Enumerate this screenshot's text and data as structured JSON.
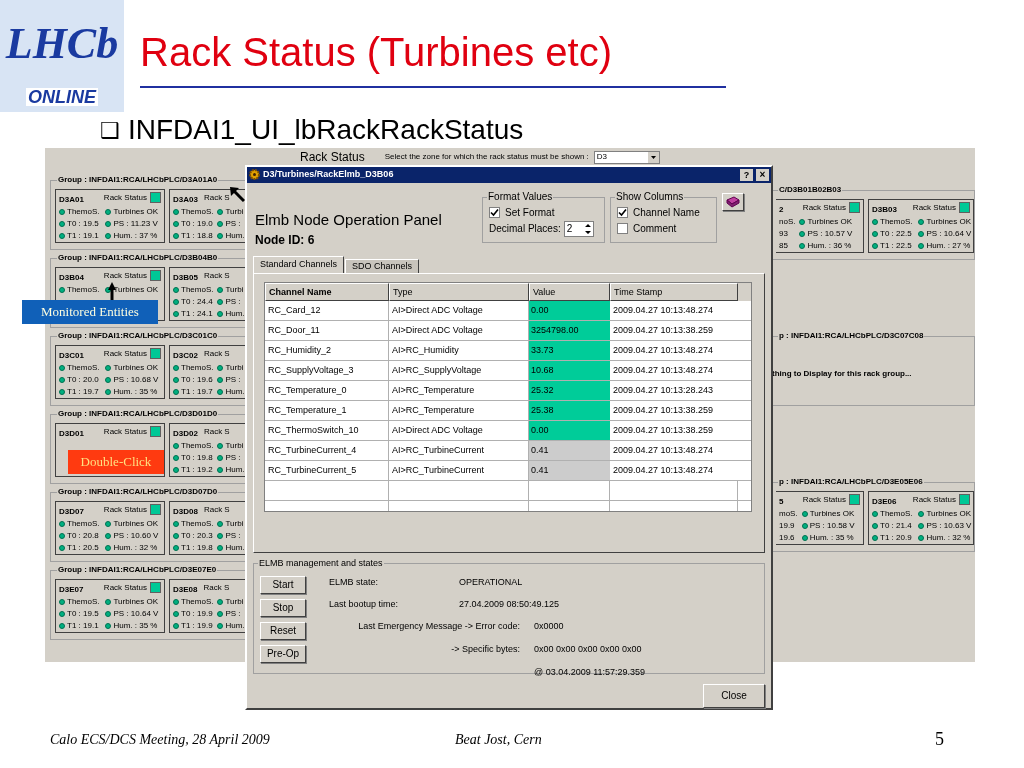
{
  "logo": {
    "text": "LHCb",
    "subtext": "ONLINE"
  },
  "slide_title": "Rack Status (Turbines etc)",
  "subtitle": {
    "bullet": "❑",
    "text": "INFDAI1_UI_lbRackRackStatus"
  },
  "app": {
    "title": "Rack Status",
    "zone_label": "Select the zone for which the rack status must be shown :",
    "zone_value": "D3",
    "left_groups": [
      {
        "title": "Group : INFDAI1:RCA/LHCbPLC/D3A01A0",
        "cards": [
          {
            "name": "D3A01",
            "kind": "full",
            "rack_label": "Rack Status",
            "color": "#00c896",
            "rows": [
              [
                "ThemoS.",
                "Turbines OK"
              ],
              [
                "T0 : 19.5",
                "PS : 11.23 V"
              ],
              [
                "T1 : 19.1",
                "Hum. : 37 %"
              ]
            ]
          },
          {
            "name": "D3A03",
            "kind": "rightcut",
            "rack_label": "Rack S",
            "rows": [
              [
                "ThemoS.",
                "Turbi"
              ],
              [
                "T0 : 19.0",
                "PS :"
              ],
              [
                "T1 : 18.8",
                "Hum."
              ]
            ]
          }
        ]
      },
      {
        "title": "Group : INFDAI1:RCA/LHCbPLC/D3B04B0",
        "cards": [
          {
            "name": "D3B04",
            "kind": "full",
            "rack_label": "Rack Status",
            "color": "#00c896",
            "rows": [
              [
                "ThemoS.",
                "Turbines OK"
              ]
            ]
          },
          {
            "name": "D3B05",
            "kind": "rightcut",
            "rack_label": "Rack S",
            "rows": [
              [
                "ThemoS.",
                "Turbi"
              ],
              [
                "T0 : 24.4",
                "PS :"
              ],
              [
                "T1 : 24.1",
                "Hum."
              ]
            ]
          }
        ]
      },
      {
        "title": "Group : INFDAI1:RCA/LHCbPLC/D3C01C0",
        "cards": [
          {
            "name": "D3C01",
            "kind": "full",
            "rack_label": "Rack Status",
            "color": "#00c896",
            "rows": [
              [
                "ThemoS.",
                "Turbines OK"
              ],
              [
                "T0 : 20.0",
                "PS : 10.68 V"
              ],
              [
                "T1 : 19.7",
                "Hum. : 35 %"
              ]
            ]
          },
          {
            "name": "D3C02",
            "kind": "rightcut",
            "rack_label": "Rack S",
            "rows": [
              [
                "ThemoS.",
                "Turbi"
              ],
              [
                "T0 : 19.6",
                "PS :"
              ],
              [
                "T1 : 19.7",
                "Hum."
              ]
            ]
          }
        ]
      },
      {
        "title": "Group : INFDAI1:RCA/LHCbPLC/D3D01D0",
        "cards": [
          {
            "name": "D3D01",
            "kind": "full",
            "rack_label": "Rack Status",
            "color": "#00c896"
          },
          {
            "name": "D3D02",
            "kind": "rightcut",
            "rack_label": "Rack S",
            "rows": [
              [
                "ThemoS.",
                "Turbi"
              ],
              [
                "T0 : 19.8",
                "PS :"
              ],
              [
                "T1 : 19.2",
                "Hum."
              ]
            ]
          }
        ]
      },
      {
        "title": "Group : INFDAI1:RCA/LHCbPLC/D3D07D0",
        "cards": [
          {
            "name": "D3D07",
            "kind": "full",
            "rack_label": "Rack Status",
            "color": "#00c896",
            "rows": [
              [
                "ThemoS.",
                "Turbines OK"
              ],
              [
                "T0 : 20.8",
                "PS : 10.60 V"
              ],
              [
                "T1 : 20.5",
                "Hum. : 32 %"
              ]
            ]
          },
          {
            "name": "D3D08",
            "kind": "rightcut",
            "rack_label": "Rack S",
            "rows": [
              [
                "ThemoS.",
                "Turbi"
              ],
              [
                "T0 : 20.3",
                "PS :"
              ],
              [
                "T1 : 19.8",
                "Hum."
              ]
            ]
          }
        ]
      },
      {
        "title": "Group : INFDAI1:RCA/LHCbPLC/D3E07E0",
        "cards": [
          {
            "name": "D3E07",
            "kind": "full",
            "rack_label": "Rack Status",
            "color": "#00c896",
            "rows": [
              [
                "ThemoS.",
                "Turbines OK"
              ],
              [
                "T0 : 19.5",
                "PS : 10.64 V"
              ],
              [
                "T1 : 19.1",
                "Hum. : 35 %"
              ]
            ]
          },
          {
            "name": "D3E08",
            "kind": "rightcut",
            "rack_label": "Rack S",
            "rows": [
              [
                "ThemoS.",
                "Turbi"
              ],
              [
                "T0 : 19.9",
                "PS :"
              ],
              [
                "T1 : 19.9",
                "Hum."
              ]
            ]
          }
        ]
      }
    ],
    "right_groups": [
      {
        "title": "C/D3B01B02B03",
        "cards": [
          {
            "name": "2",
            "kind": "leftcut",
            "rack_label": "Rack Status",
            "color": "#00c896",
            "rows": [
              [
                "noS.",
                "Turbines OK"
              ],
              [
                "93",
                "PS : 10.57 V"
              ],
              [
                "85",
                "Hum. : 36 %"
              ]
            ]
          },
          {
            "name": "D3B03",
            "kind": "full",
            "rack_label": "Rack Status",
            "color": "#00c896",
            "rows": [
              [
                "ThemoS.",
                "Turbines OK"
              ],
              [
                "T0 : 22.5",
                "PS : 10.64 V"
              ],
              [
                "T1 : 22.5",
                "Hum. : 27 %"
              ]
            ]
          }
        ]
      },
      {
        "title": "p : INFDAI1:RCA/LHCbPLC/D3C07C08",
        "message": "thing to Display for this rack group..."
      },
      {
        "title": "p : INFDAI1:RCA/LHCbPLC/D3E05E06",
        "cards": [
          {
            "name": "5",
            "kind": "leftcut",
            "rack_label": "Rack Status",
            "color": "#00c896",
            "rows": [
              [
                "moS.",
                "Turbines OK"
              ],
              [
                "19.9",
                "PS : 10.58 V"
              ],
              [
                "19.6",
                "Hum. : 35 %"
              ]
            ]
          },
          {
            "name": "D3E06",
            "kind": "full",
            "rack_label": "Rack Status",
            "color": "#00c896",
            "rows": [
              [
                "ThemoS.",
                "Turbines OK"
              ],
              [
                "T0 : 21.4",
                "PS : 10.63 V"
              ],
              [
                "T1 : 20.9",
                "Hum. : 32 %"
              ]
            ]
          }
        ]
      }
    ]
  },
  "dialog": {
    "title": "D3/Turbines/RackElmb_D3B06",
    "help": "?",
    "close": "×",
    "heading": "Elmb Node Operation Panel",
    "node_id": "Node ID: 6",
    "format_values": {
      "legend": "Format Values",
      "set_format": {
        "label": "Set Format",
        "checked": true
      },
      "decimal_label": "Decimal Places:",
      "decimal_value": "2"
    },
    "show_columns": {
      "legend": "Show Columns",
      "options": [
        {
          "label": "Channel Name",
          "checked": true
        },
        {
          "label": "Comment",
          "checked": false
        }
      ]
    },
    "tabs": [
      {
        "label": "Standard Channels",
        "selected": true
      },
      {
        "label": "SDO Channels",
        "selected": false
      }
    ],
    "table": {
      "columns": [
        "Channel Name",
        "Type",
        "Value",
        "Time Stamp"
      ],
      "rows": [
        {
          "name": "RC_Card_12",
          "type": "AI>Direct ADC Voltage",
          "value": "0.00",
          "color": "#00cc99",
          "time": "2009.04.27 10:13:48.274"
        },
        {
          "name": "RC_Door_11",
          "type": "AI>Direct ADC Voltage",
          "value": "3254798.00",
          "color": "#00cc99",
          "time": "2009.04.27 10:13:38.259"
        },
        {
          "name": "RC_Humidity_2",
          "type": "AI>RC_Humidity",
          "value": "33.73",
          "color": "#00cc99",
          "time": "2009.04.27 10:13:48.274"
        },
        {
          "name": "RC_SupplyVoltage_3",
          "type": "AI>RC_SupplyVoltage",
          "value": "10.68",
          "color": "#00cc99",
          "time": "2009.04.27 10:13:48.274"
        },
        {
          "name": "RC_Temperature_0",
          "type": "AI>RC_Temperature",
          "value": "25.32",
          "color": "#00cc99",
          "time": "2009.04.27 10:13:28.243"
        },
        {
          "name": "RC_Temperature_1",
          "type": "AI>RC_Temperature",
          "value": "25.38",
          "color": "#00cc99",
          "time": "2009.04.27 10:13:38.259"
        },
        {
          "name": "RC_ThermoSwitch_10",
          "type": "AI>Direct ADC Voltage",
          "value": "0.00",
          "color": "#00cc99",
          "time": "2009.04.27 10:13:38.259"
        },
        {
          "name": "RC_TurbineCurrent_4",
          "type": "AI>RC_TurbineCurrent",
          "value": "0.41",
          "color": "#cccccc",
          "time": "2009.04.27 10:13:48.274"
        },
        {
          "name": "RC_TurbineCurrent_5",
          "type": "AI>RC_TurbineCurrent",
          "value": "0.41",
          "color": "#cccccc",
          "time": "2009.04.27 10:13:48.274"
        }
      ]
    },
    "elmb": {
      "legend": "ELMB management and states",
      "buttons": [
        "Start",
        "Stop",
        "Reset",
        "Pre-Op"
      ],
      "state_label": "ELMB state:",
      "state_value": "OPERATIONAL",
      "bootup_label": "Last bootup time:",
      "bootup_value": "27.04.2009 08:50:49.125",
      "error_label": "Last Emergency Message -> Error code:",
      "error_value": "0x0000",
      "bytes_label": "-> Specific bytes:",
      "bytes_value": "0x00 0x00 0x00 0x00 0x00",
      "timestamp": "@ 03.04.2009 11:57:29.359"
    },
    "close_button": "Close"
  },
  "callouts": [
    "Monitored Entities",
    "Double-Click"
  ],
  "footer": {
    "meeting": "Calo ECS/DCS Meeting, 28 April 2009",
    "author": "Beat Jost, Cern",
    "page": "5"
  }
}
